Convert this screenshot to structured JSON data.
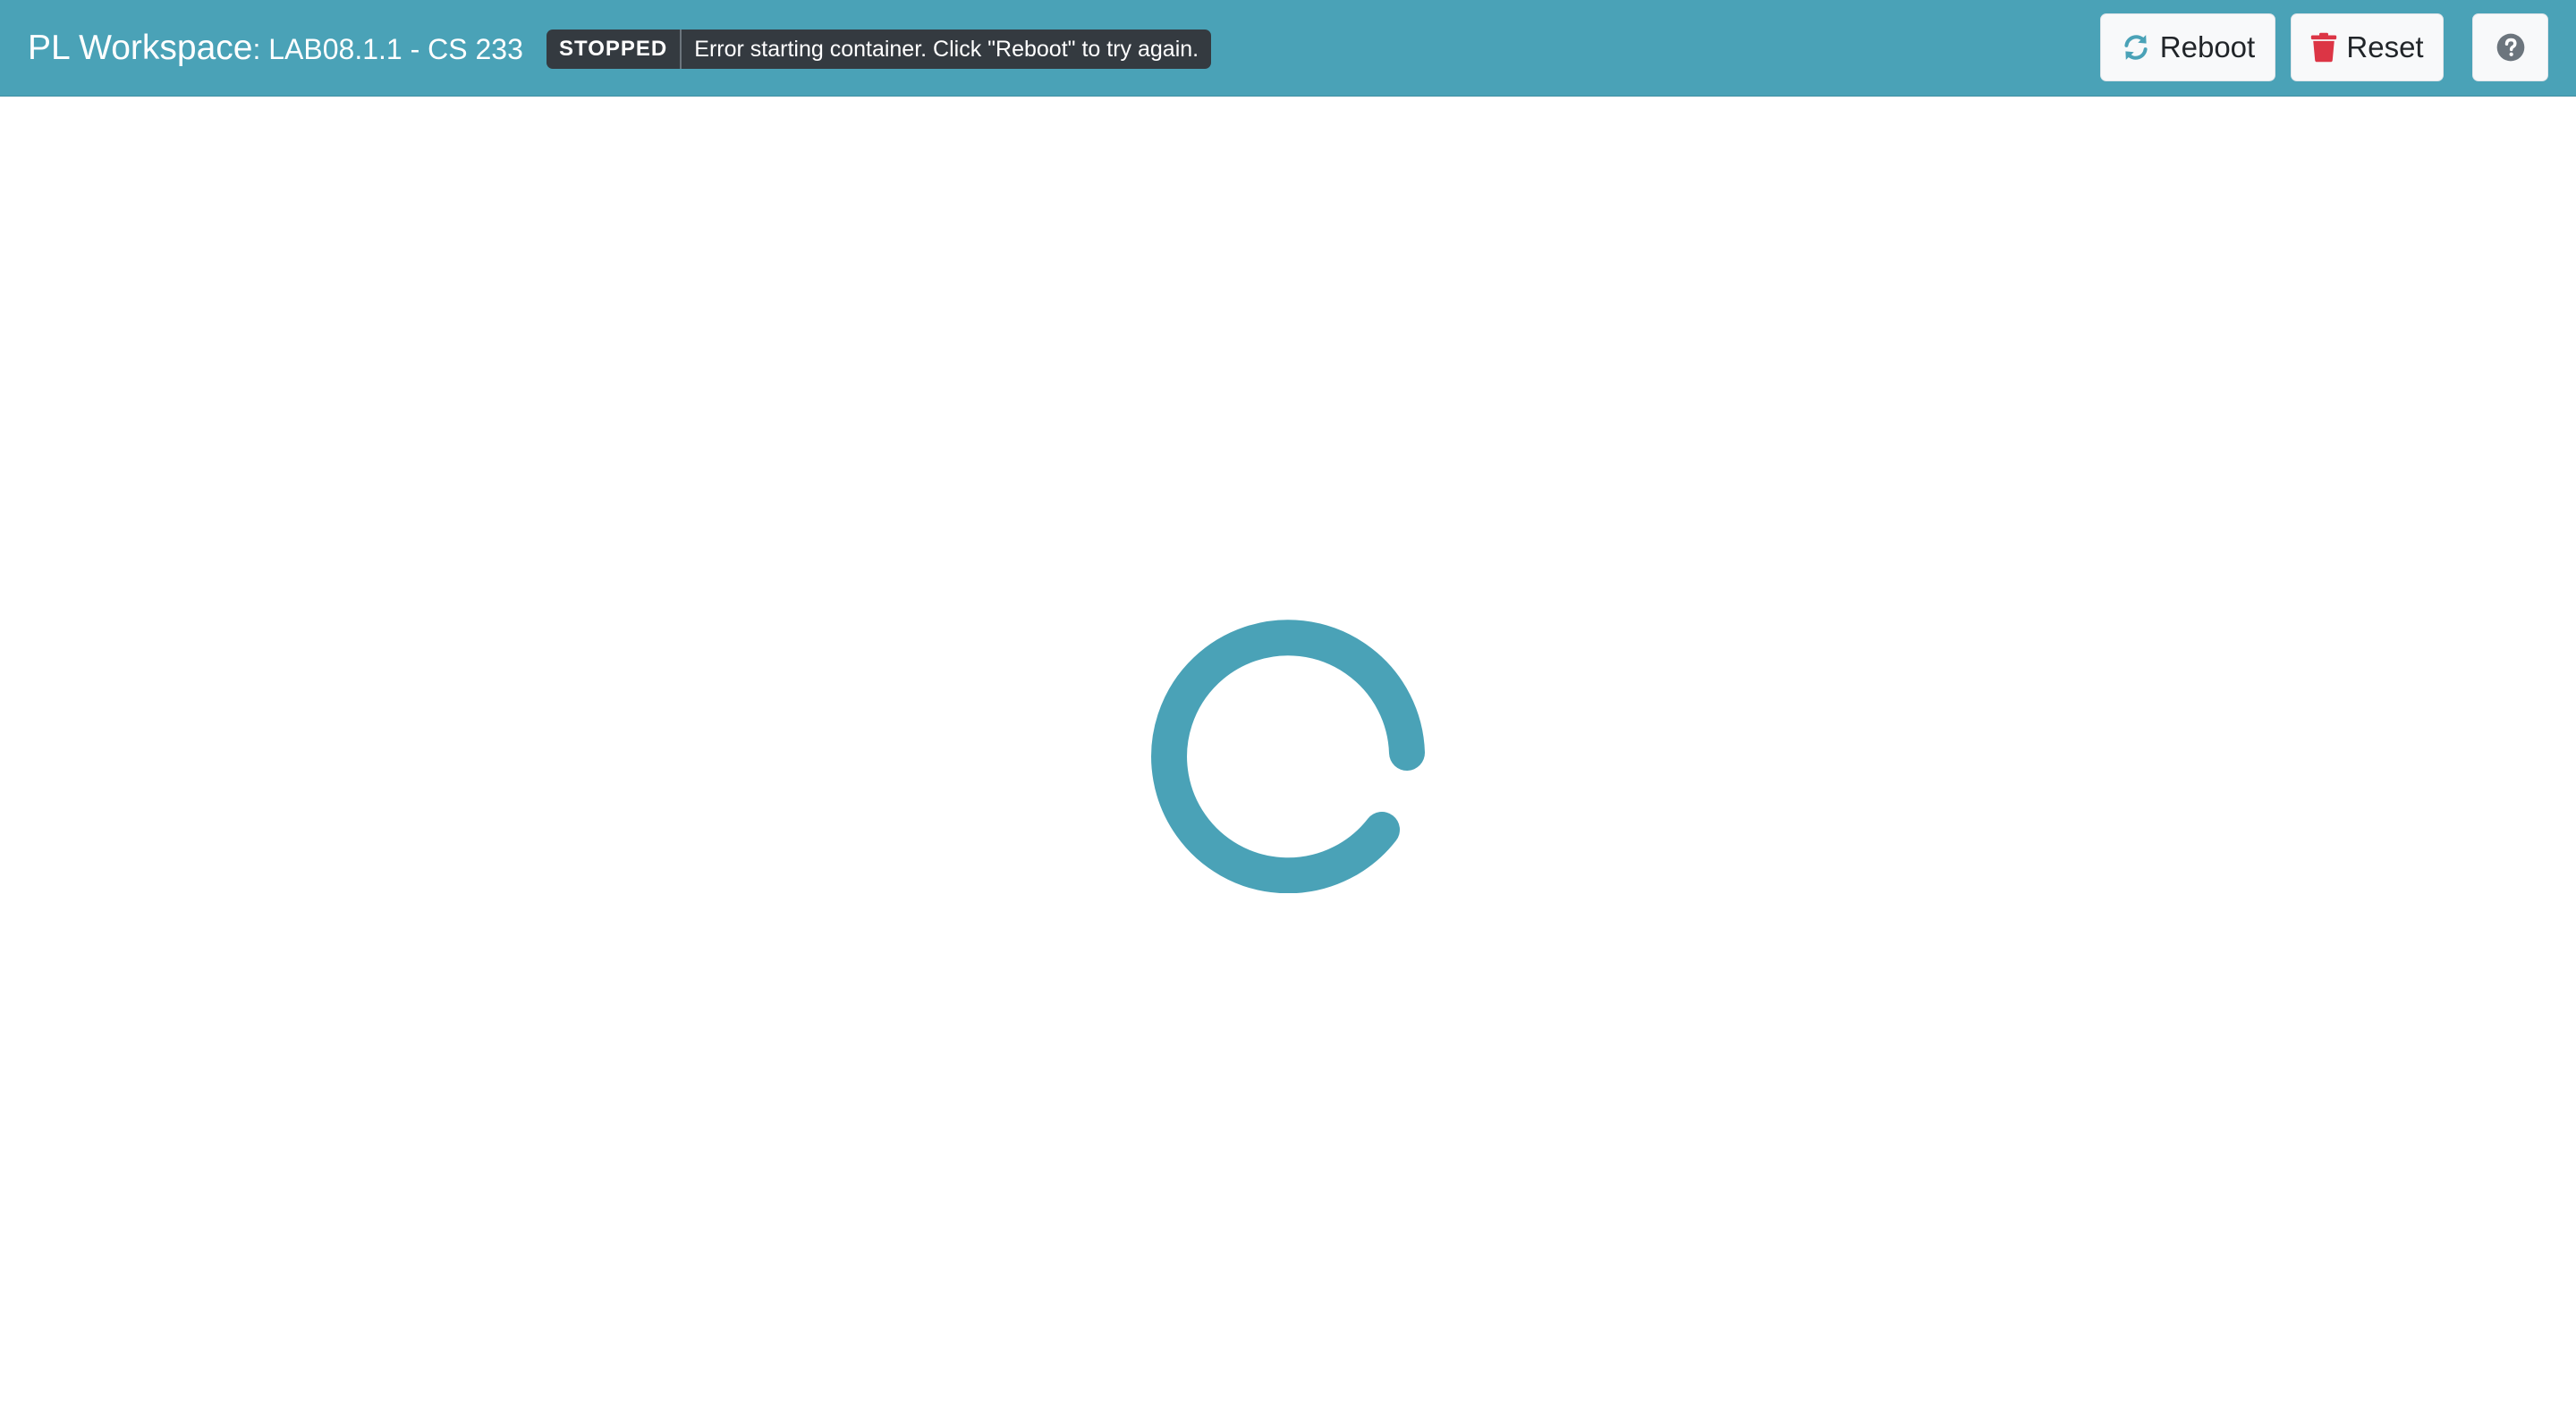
{
  "header": {
    "brand_main": "PL Workspace",
    "brand_sub": ": LAB08.1.1 - CS 233",
    "status_badge": "STOPPED",
    "status_message": "Error starting container. Click \"Reboot\" to try again."
  },
  "toolbar": {
    "reboot_label": "Reboot",
    "reboot_icon": "sync-icon",
    "reset_label": "Reset",
    "reset_icon": "trash-icon",
    "help_icon": "question-circle-icon"
  },
  "colors": {
    "navbar": "#4aa2b7",
    "badge_bg": "#343a40",
    "reset_icon": "#dc3545",
    "reboot_icon": "#4aa2b7",
    "spinner": "#4aa2b7"
  },
  "main": {
    "loading_indicator": "spinner-icon"
  }
}
